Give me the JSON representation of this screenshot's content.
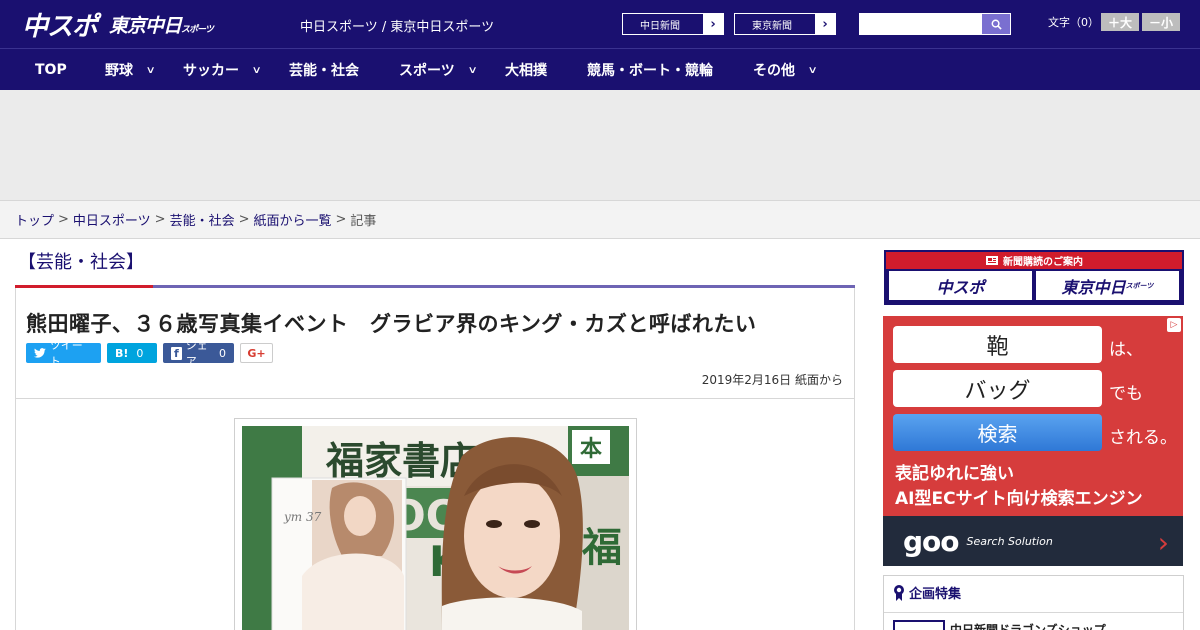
{
  "header": {
    "logo_main": "中スポ",
    "logo_sub": "東京中日",
    "logo_sub_small": "スポーツ",
    "site_title": "中日スポーツ / 東京中日スポーツ",
    "links": [
      {
        "label": "中日新聞"
      },
      {
        "label": "東京新聞"
      }
    ],
    "search": {
      "value": "",
      "placeholder": ""
    },
    "font_size_label": "文字（0）",
    "font_larger": "＋大",
    "font_smaller": "－小"
  },
  "nav": {
    "items": [
      {
        "label": "TOP",
        "has_menu": false
      },
      {
        "label": "野球",
        "has_menu": true
      },
      {
        "label": "サッカー",
        "has_menu": true
      },
      {
        "label": "芸能・社会",
        "has_menu": false
      },
      {
        "label": "スポーツ",
        "has_menu": true
      },
      {
        "label": "大相撲",
        "has_menu": false
      },
      {
        "label": "競馬・ボート・競輪",
        "has_menu": false
      },
      {
        "label": "その他",
        "has_menu": true
      }
    ]
  },
  "breadcrumb": {
    "items": [
      "トップ",
      "中日スポーツ",
      "芸能・社会",
      "紙面から一覧"
    ],
    "current": "記事",
    "separator": ">"
  },
  "article": {
    "category": "【芸能・社会】",
    "title": "熊田曜子、３６歳写真集イベント　グラビア界のキング・カズと呼ばれたい",
    "share": {
      "tweet": "ツイート",
      "hatena": "B!",
      "hatena_count": "0",
      "facebook": "シェア",
      "facebook_count": "0",
      "gplus": "G+"
    },
    "date": "2019年2月16日 紙面から",
    "photo_signs": {
      "store": "福家書店",
      "book": "本",
      "side": "福",
      "banner": "OOK",
      "banner2": "KU",
      "book_cover": "ym 37"
    }
  },
  "sidebar": {
    "subscribe": {
      "heading": "新聞購読のご案内",
      "left": "中スポ",
      "right": "東京中日",
      "right_small": "スポーツ"
    },
    "ad": {
      "row1_word": "鞄",
      "row1_suffix": "は、",
      "row2_word": "バッグ",
      "row2_suffix": "でも",
      "row3_word": "検索",
      "row3_suffix": "される。",
      "copy_line1": "表記ゆれに強い",
      "copy_line2": "AI型ECサイト向け検索エンジン",
      "brand": "goo",
      "brand_sub": "Search Solution"
    },
    "feature": {
      "title": "企画特集",
      "item1": "中日新聞ドラゴンズショップ"
    }
  },
  "colors": {
    "brand_navy": "#1a1070",
    "accent_red": "#d11c2c",
    "ad_red": "#d63c3c"
  }
}
